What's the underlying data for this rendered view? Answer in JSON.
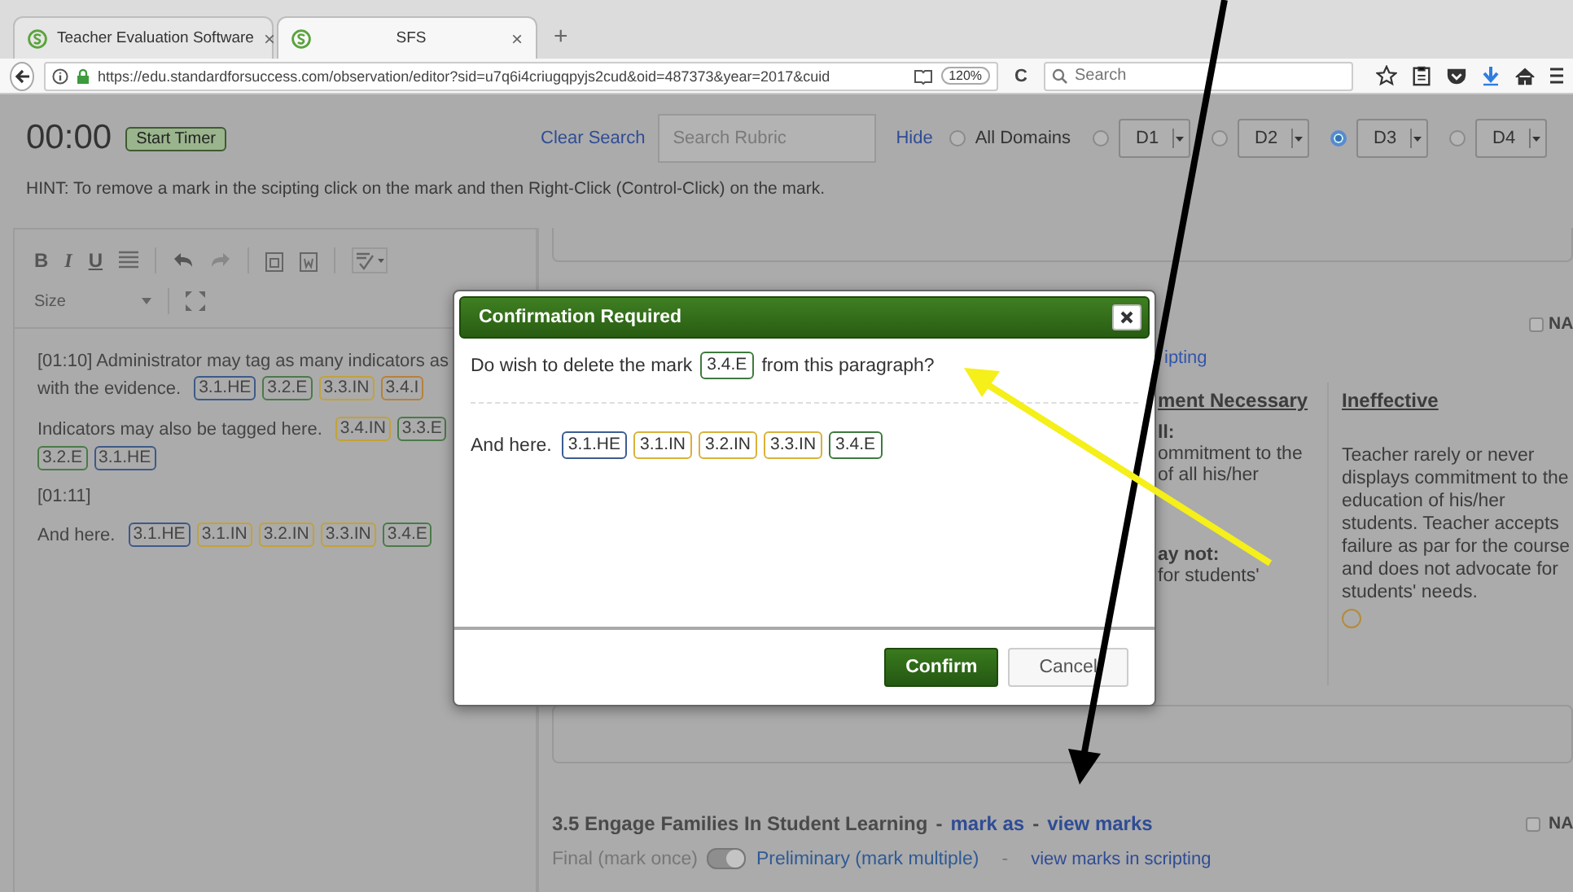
{
  "browser": {
    "tabs": [
      {
        "title": "Teacher Evaluation Software",
        "close": "×",
        "selected": false
      },
      {
        "title": "SFS",
        "close": "×",
        "selected": true
      }
    ],
    "new_tab": "+",
    "url": "https://edu.standardforsuccess.com/observation/editor?sid=u7q6i4criugqpyjs2cud&oid=487373&year=2017&cuid",
    "zoom": "120%",
    "reload": "C",
    "search": {
      "placeholder": "Search"
    }
  },
  "header": {
    "timer": "00:00",
    "start_button": "Start Timer",
    "clear_search": "Clear Search",
    "search": {
      "placeholder": "Search Rubric"
    },
    "hide": "Hide",
    "domains": [
      {
        "label": "All Domains",
        "kind": "radio",
        "selected": false
      },
      {
        "label": "D1",
        "kind": "select",
        "selected": false
      },
      {
        "label": "D2",
        "kind": "select",
        "selected": false
      },
      {
        "label": "D3",
        "kind": "select",
        "selected": true
      },
      {
        "label": "D4",
        "kind": "select",
        "selected": false
      }
    ],
    "hint": "HINT: To remove a mark in the scipting click on the mark and then Right-Click (Control-Click) on the mark."
  },
  "editor": {
    "format_buttons": [
      "B",
      "I",
      "U"
    ],
    "size_label": "Size",
    "paragraphs": [
      {
        "lines": [
          {
            "text": "[01:10] Administrator may tag as many indicators as"
          },
          {
            "text": "with the evidence.",
            "tags": [
              {
                "label": "3.1.HE",
                "color": "#3d5a88"
              },
              {
                "label": "3.2.E",
                "color": "#4a7a48"
              },
              {
                "label": "3.3.IN",
                "color": "#c2a23a"
              },
              {
                "label": "3.4.I",
                "color": "#b5823a"
              }
            ]
          }
        ]
      },
      {
        "lines": [
          {
            "text": "Indicators may also be tagged here.",
            "tags": [
              {
                "label": "3.4.IN",
                "color": "#c2a23a"
              },
              {
                "label": "3.3.E",
                "color": "#4a7a48"
              }
            ]
          },
          {
            "tags": [
              {
                "label": "3.2.E",
                "color": "#4a7a48"
              },
              {
                "label": "3.1.HE",
                "color": "#3d5a88"
              }
            ]
          }
        ]
      },
      {
        "lines": [
          {
            "text": "[01:11]"
          }
        ]
      },
      {
        "lines": [
          {
            "text": "And here.",
            "tags": [
              {
                "label": "3.1.HE",
                "color": "#3d5a88"
              },
              {
                "label": "3.1.IN",
                "color": "#c2a23a"
              },
              {
                "label": "3.2.IN",
                "color": "#c2a23a"
              },
              {
                "label": "3.3.IN",
                "color": "#c2a23a"
              },
              {
                "label": "3.4.E",
                "color": "#4a7a48"
              }
            ]
          }
        ]
      }
    ]
  },
  "rubric": {
    "na": {
      "label": "NA",
      "checked": false
    },
    "scripting_link": "ipting",
    "columns": [
      {
        "title": "ment Necessary",
        "blocks": [
          [
            "ll:",
            "ommitment to the",
            "of all his/her"
          ],
          [
            "ay not:",
            "for students'"
          ]
        ]
      },
      {
        "title": "Ineffective",
        "text": "Teacher rarely or never displays commitment to the education of his/her students. Teacher accepts failure as par for the course and does not advocate for students' needs.",
        "rating": {
          "selected": false
        }
      }
    ]
  },
  "section": {
    "title": "3.5 Engage Families In Student Learning",
    "separator": "-",
    "mark_as": "mark as",
    "separator_2": "-",
    "view_marks": "view marks",
    "na": {
      "label": "NA",
      "checked": false
    },
    "modes": [
      {
        "label": "Final (mark once)",
        "selected": false
      },
      {
        "label": "Preliminary (mark multiple)",
        "selected": true
      }
    ],
    "toggle": {
      "on": true
    },
    "separator_3": "-",
    "view_in_scripting": "view marks in scripting"
  },
  "dialog": {
    "title": "Confirmation Required",
    "message_before": "Do wish to delete the mark",
    "mark": {
      "label": "3.4.E",
      "color": "#3e7a3e"
    },
    "message_after": "from this paragraph?",
    "preview_text": "And here.",
    "preview_tags": [
      {
        "label": "3.1.HE",
        "color": "#3b5d8f"
      },
      {
        "label": "3.1.IN",
        "color": "#d9b13a"
      },
      {
        "label": "3.2.IN",
        "color": "#d9b13a"
      },
      {
        "label": "3.3.IN",
        "color": "#d9b13a"
      },
      {
        "label": "3.4.E",
        "color": "#3e7a3e"
      }
    ],
    "buttons": [
      {
        "label": "Confirm",
        "kind": "primary"
      },
      {
        "label": "Cancel",
        "kind": "default"
      }
    ]
  }
}
